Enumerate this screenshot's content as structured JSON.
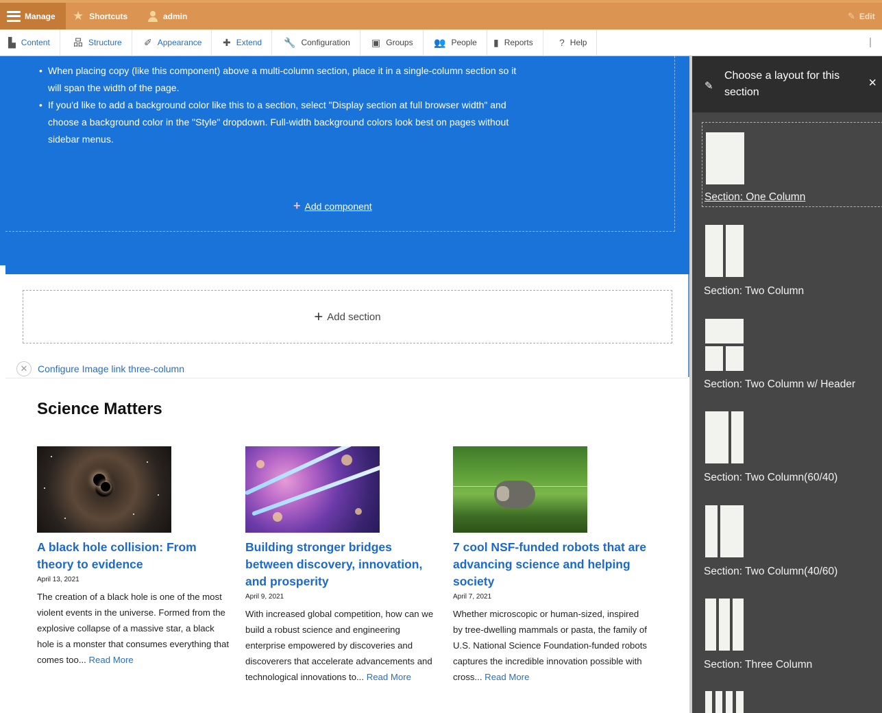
{
  "toolbar": {
    "manage": "Manage",
    "shortcuts": "Shortcuts",
    "user": "admin",
    "edit": "Edit"
  },
  "tray": {
    "items": [
      {
        "label": "Content",
        "icon": "document-icon"
      },
      {
        "label": "Structure",
        "icon": "sitemap-icon"
      },
      {
        "label": "Appearance",
        "icon": "brush-icon"
      },
      {
        "label": "Extend",
        "icon": "puzzle-icon"
      },
      {
        "label": "Configuration",
        "icon": "wrench-icon"
      },
      {
        "label": "Groups",
        "icon": "groups-icon"
      },
      {
        "label": "People",
        "icon": "people-icon"
      },
      {
        "label": "Reports",
        "icon": "bar-chart-icon"
      },
      {
        "label": "Help",
        "icon": "help-icon"
      }
    ]
  },
  "blue_section": {
    "bullets": [
      "When placing copy (like this component) above a multi-column section, place it in a single-column section so it will span the width of the page.",
      "If you'd like to add a background color like this to a section, select \"Display section at full browser width\" and choose a background color in the \"Style\" dropdown. Full-width background colors look best on pages without sidebar menus."
    ],
    "add_component": "Add component"
  },
  "add_section": "Add section",
  "configure_link": "Configure Image link three-column",
  "science": {
    "title": "Science Matters",
    "cards": [
      {
        "title": "A black hole collision: From theory to evidence",
        "date": "April 13, 2021",
        "desc": "The creation of a black hole is one of the most violent events in the universe. Formed from the explosive collapse of a massive star, a black hole is a monster that consumes everything that comes too...",
        "read_more": "Read More"
      },
      {
        "title": "Building stronger bridges between discovery, innovation, and prosperity",
        "date": "April 9, 2021",
        "desc": "With increased global competition, how can we build a robust science and engineering enterprise empowered by discoveries and discoverers that accelerate advancements and technological innovations to...",
        "read_more": "Read More"
      },
      {
        "title": "7 cool NSF-funded robots that are advancing science and helping society",
        "date": "April 7, 2021",
        "desc": "Whether microscopic or human-sized, inspired by tree-dwelling mammals or pasta, the family of U.S. National Science Foundation-funded robots captures the incredible innovation possible with cross...",
        "read_more": "Read More"
      }
    ]
  },
  "layout_panel": {
    "title": "Choose a layout for this section",
    "options": [
      "Section: One Column",
      "Section: Two Column",
      "Section: Two Column w/ Header",
      "Section: Two Column(60/40)",
      "Section: Two Column(40/60)",
      "Section: Three Column"
    ]
  }
}
